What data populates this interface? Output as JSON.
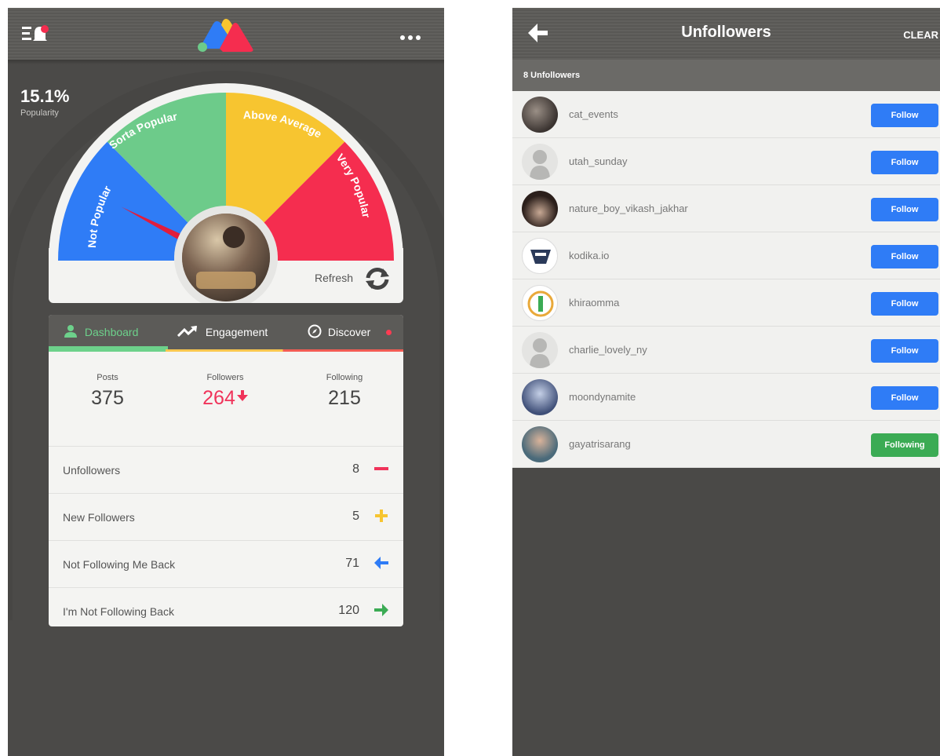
{
  "dashboard": {
    "popularity_value": "15.1%",
    "popularity_label": "Popularity",
    "popularity_fraction": 0.151,
    "gauge_segments": [
      {
        "label": "Not Popular",
        "color": "#2f7cf6"
      },
      {
        "label": "Sorta Popular",
        "color": "#6dcb8a"
      },
      {
        "label": "Above Average",
        "color": "#f7c530"
      },
      {
        "label": "Very Popular",
        "color": "#f52d4f"
      }
    ],
    "refresh_label": "Refresh",
    "tabs": [
      {
        "label": "Dashboard",
        "icon": "person-icon"
      },
      {
        "label": "Engagement",
        "icon": "trending-up-icon"
      },
      {
        "label": "Discover",
        "icon": "compass-icon"
      }
    ],
    "stats": {
      "posts_label": "Posts",
      "posts_value": "375",
      "followers_label": "Followers",
      "followers_value": "264",
      "following_label": "Following",
      "following_value": "215"
    },
    "rows": [
      {
        "label": "Unfollowers",
        "value": "8",
        "icon": "minus-icon",
        "color": "#f0335a"
      },
      {
        "label": "New Followers",
        "value": "5",
        "icon": "plus-icon",
        "color": "#f7c530"
      },
      {
        "label": "Not Following Me Back",
        "value": "71",
        "icon": "arrow-left-icon",
        "color": "#2f7cf6"
      },
      {
        "label": "I'm Not Following Back",
        "value": "120",
        "icon": "arrow-right-icon",
        "color": "#3bab54"
      }
    ]
  },
  "unfollowers": {
    "title": "Unfollowers",
    "clear_label": "CLEAR",
    "count_label": "8 Unfollowers",
    "users": [
      {
        "username": "cat_events",
        "button": "Follow"
      },
      {
        "username": "utah_sunday",
        "button": "Follow"
      },
      {
        "username": "nature_boy_vikash_jakhar",
        "button": "Follow"
      },
      {
        "username": "kodika.io",
        "button": "Follow"
      },
      {
        "username": "khiraomma",
        "button": "Follow"
      },
      {
        "username": "charlie_lovely_ny",
        "button": "Follow"
      },
      {
        "username": "moondynamite",
        "button": "Follow"
      },
      {
        "username": "gayatrisarang",
        "button": "Following"
      }
    ]
  }
}
